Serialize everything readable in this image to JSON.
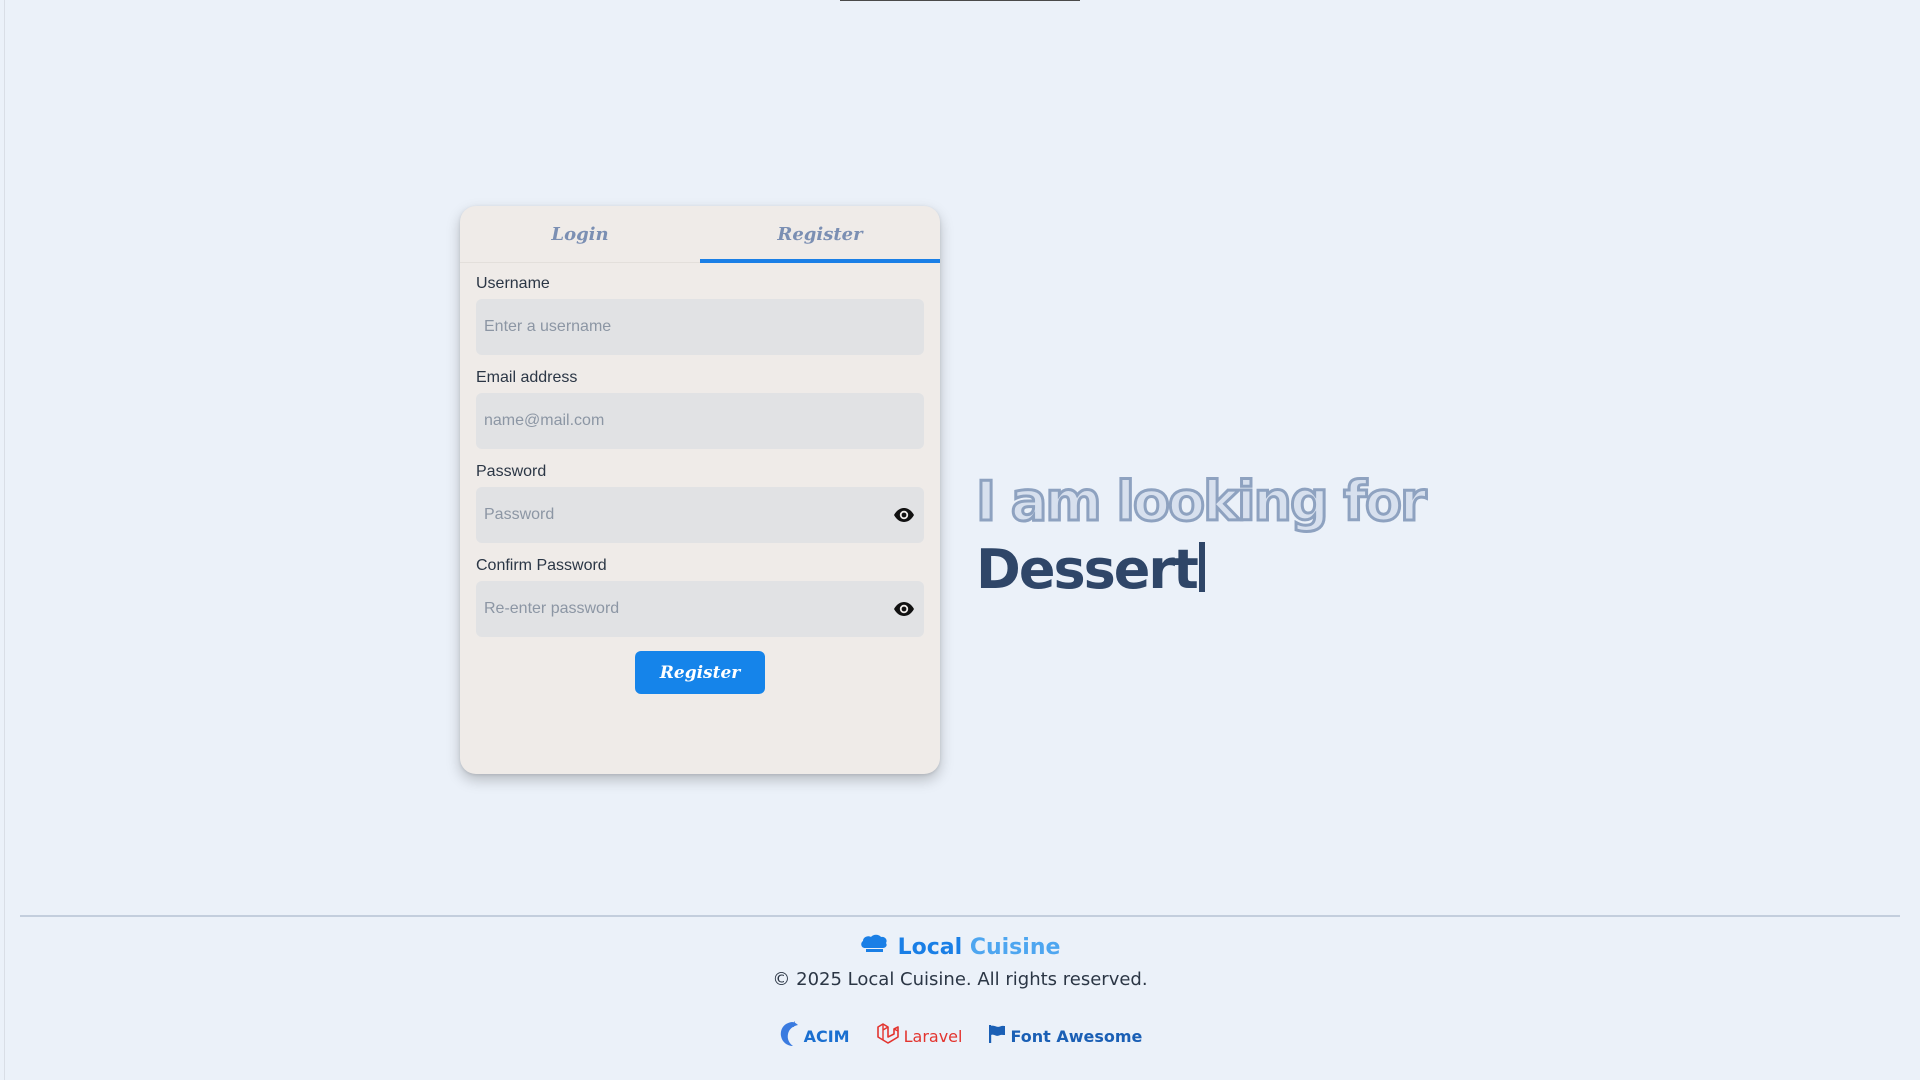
{
  "auth": {
    "tabs": [
      {
        "label": "Login",
        "active": false
      },
      {
        "label": "Register",
        "active": true
      }
    ],
    "fields": {
      "username": {
        "label": "Username",
        "placeholder": "Enter a username",
        "value": ""
      },
      "email": {
        "label": "Email address",
        "placeholder": "name@mail.com",
        "value": ""
      },
      "password": {
        "label": "Password",
        "placeholder": "Password",
        "value": ""
      },
      "confirm": {
        "label": "Confirm Password",
        "placeholder": "Re-enter password",
        "value": ""
      }
    },
    "submit_label": "Register"
  },
  "hero": {
    "line1": "I am looking for",
    "line2": "Dessert"
  },
  "footer": {
    "brand_part1": "Local",
    "brand_part2": "Cuisine",
    "copyright": "© 2025 Local Cuisine. All rights reserved.",
    "links": [
      {
        "label": "ACIM",
        "icon": "dolphin-icon"
      },
      {
        "label": "Laravel",
        "icon": "laravel-icon"
      },
      {
        "label": "Font Awesome",
        "icon": "flag-icon"
      }
    ]
  },
  "colors": {
    "accent": "#1a7fe6",
    "background": "#ebf1f9",
    "card": "#efebe8",
    "hero_dark": "#2f4668",
    "laravel": "#e3342f"
  }
}
